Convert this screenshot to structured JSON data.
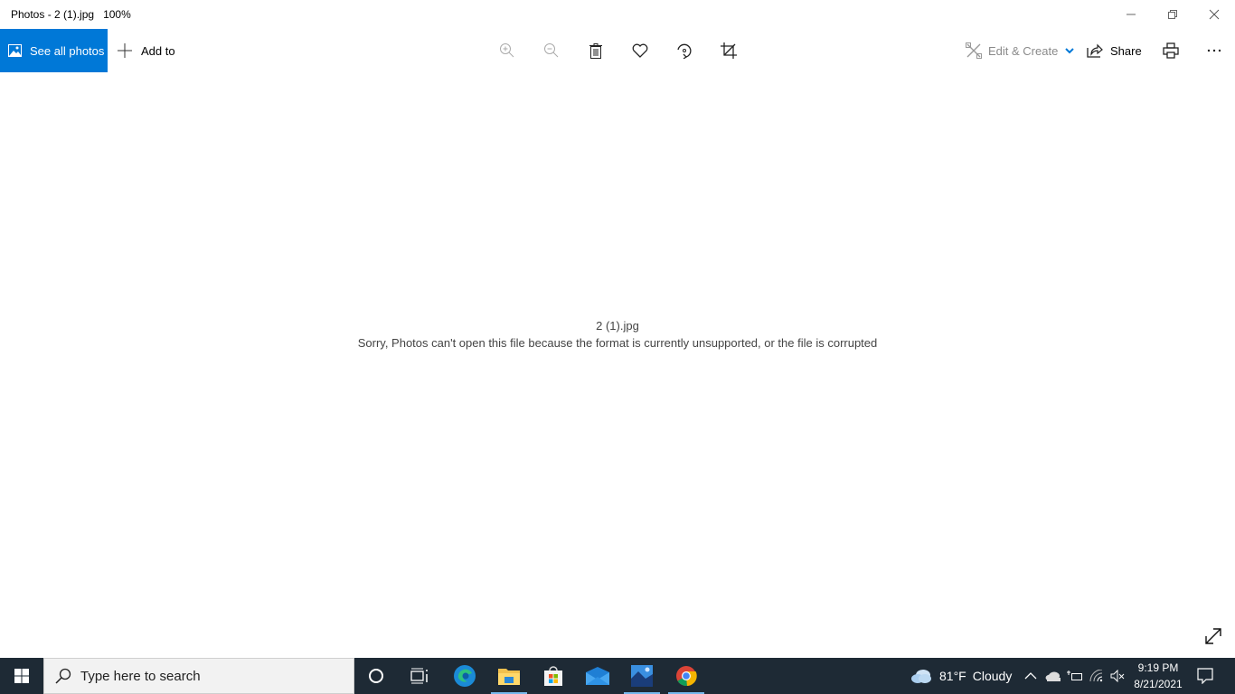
{
  "window": {
    "title": "Photos - 2 (1).jpg",
    "zoom_level": "100%",
    "controls": {
      "minimize": "minimize-icon",
      "restore": "restore-icon",
      "close": "close-icon"
    }
  },
  "toolbar": {
    "see_all_photos": "See all photos",
    "add_to": "Add to",
    "icons": [
      "zoom-in-icon",
      "zoom-out-icon",
      "delete-icon",
      "favorite-icon",
      "rotate-icon",
      "crop-icon"
    ],
    "edit_create": "Edit & Create",
    "share": "Share",
    "print": "print-icon",
    "more": "more-icon"
  },
  "content": {
    "file_name": "2 (1).jpg",
    "error_message": "Sorry, Photos can't open this file because the format is currently unsupported, or the file is corrupted"
  },
  "taskbar": {
    "search_placeholder": "Type here to search",
    "apps": [
      {
        "name": "cortana",
        "active": false
      },
      {
        "name": "task-view",
        "active": false
      },
      {
        "name": "edge",
        "active": false
      },
      {
        "name": "file-explorer",
        "active": true
      },
      {
        "name": "microsoft-store",
        "active": false
      },
      {
        "name": "mail",
        "active": false
      },
      {
        "name": "photos",
        "active": true
      },
      {
        "name": "chrome",
        "active": true
      }
    ],
    "weather": {
      "temp": "81°F",
      "condition": "Cloudy"
    },
    "clock": {
      "time": "9:19 PM",
      "date": "8/21/2021"
    }
  }
}
